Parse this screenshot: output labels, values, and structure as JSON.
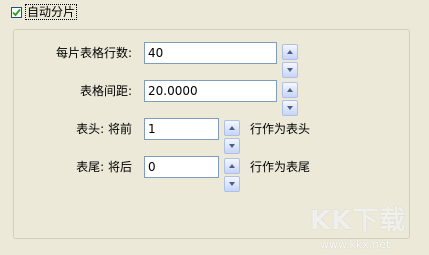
{
  "auto_split": {
    "label": "自动分片",
    "checked": true
  },
  "fields": {
    "rows_per_table": {
      "label": "每片表格行数:",
      "value": "40"
    },
    "table_spacing": {
      "label": "表格间距:",
      "value": "20.0000"
    },
    "header": {
      "label": "表头: 将前",
      "value": "1",
      "suffix": "行作为表头"
    },
    "footer": {
      "label": "表尾: 将后",
      "value": "0",
      "suffix": "行作为表尾"
    }
  },
  "watermark": {
    "logo": "KK下载",
    "url": "www.kkx.net"
  }
}
